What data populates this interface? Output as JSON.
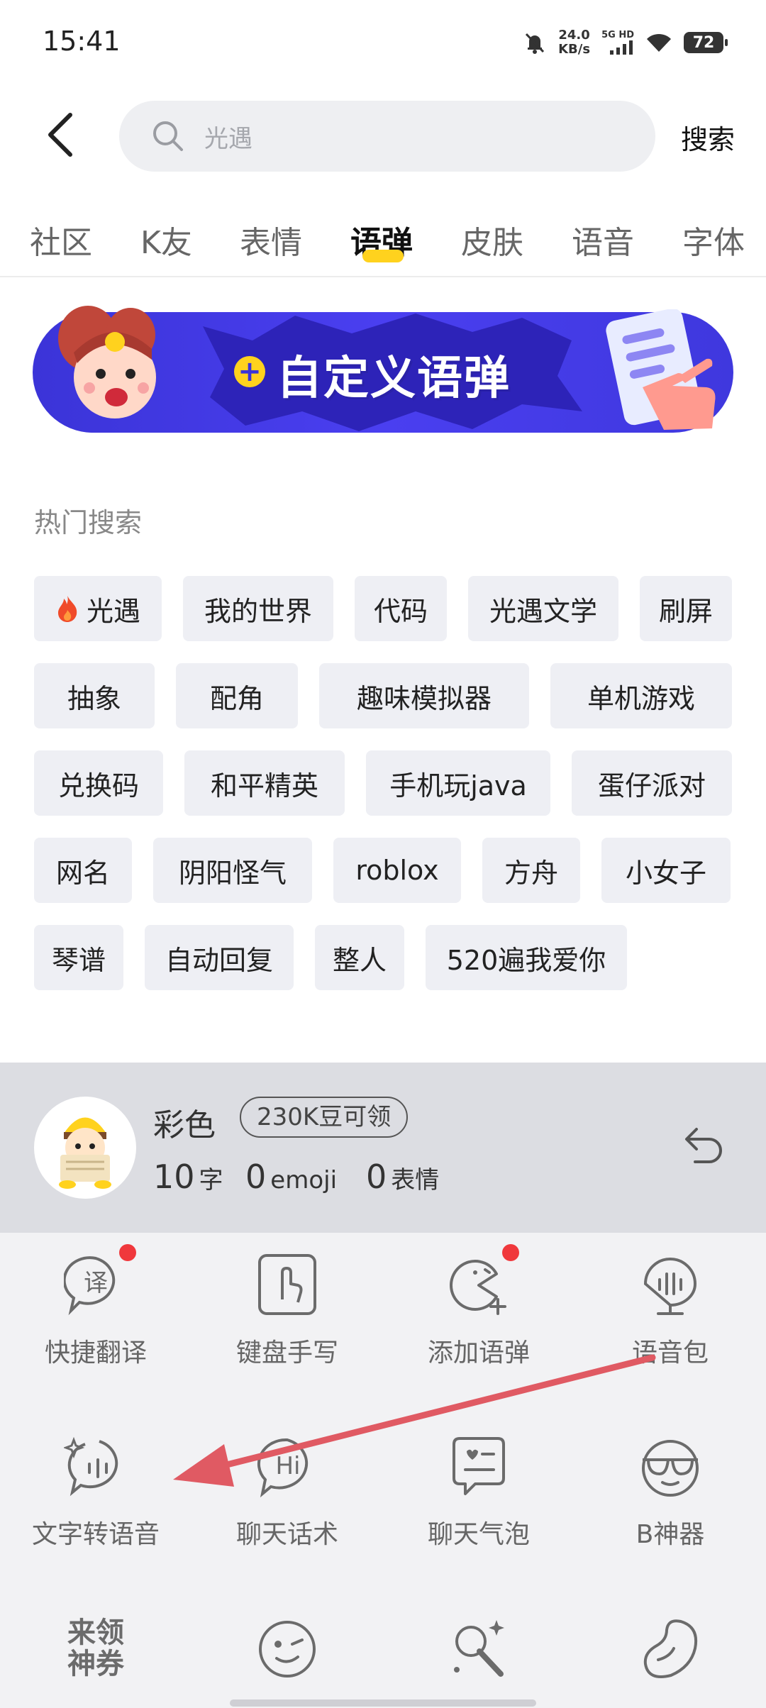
{
  "status_bar": {
    "time": "15:41",
    "net_speed_value": "24.0",
    "net_speed_unit": "KB/s",
    "network": "5G HD",
    "battery": "72"
  },
  "header": {
    "search_placeholder": "光遇",
    "search_button": "搜索"
  },
  "tabs": [
    "社区",
    "K友",
    "表情",
    "语弹",
    "皮肤",
    "语音",
    "字体"
  ],
  "active_tab": "语弹",
  "banner": {
    "title": "自定义语弹"
  },
  "hot_search": {
    "title": "热门搜索",
    "tags": [
      "光遇",
      "我的世界",
      "代码",
      "光遇文学",
      "刷屏",
      "抽象",
      "配角",
      "趣味模拟器",
      "单机游戏",
      "兑换码",
      "和平精英",
      "手机玩java",
      "蛋仔派对",
      "网名",
      "阴阳怪气",
      "roblox",
      "方舟",
      "小女子",
      "琴谱",
      "自动回复",
      "整人",
      "520遍我爱你"
    ]
  },
  "keyboard": {
    "name": "彩色",
    "badge": "230K豆可领",
    "stats": [
      {
        "num": "10",
        "unit": "字"
      },
      {
        "num": "0",
        "unit": "emoji"
      },
      {
        "num": "0",
        "unit": "表情"
      }
    ],
    "tools": [
      "快捷翻译",
      "键盘手写",
      "添加语弹",
      "语音包",
      "文字转语音",
      "聊天话术",
      "聊天气泡",
      "B神器"
    ],
    "tool_row3_text_icon": "来领\n神券",
    "translate_icon_char": "译",
    "hi_icon_text": "Hi"
  },
  "colors": {
    "accent_yellow": "#ffd21e",
    "banner_blue": "#3b34d8",
    "red_dot": "#f0383c",
    "arrow_red": "#e05a63"
  }
}
